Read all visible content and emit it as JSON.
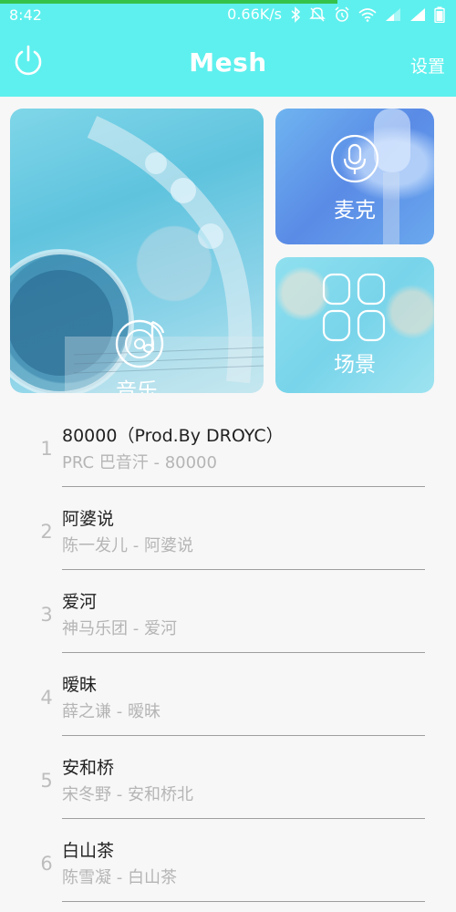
{
  "status_bar": {
    "time": "8:42",
    "net_speed": "0.66K/s",
    "icons": [
      "bluetooth-icon",
      "alarm-off-icon",
      "alarm-icon",
      "wifi-icon",
      "signal-icon",
      "signal-icon",
      "battery-icon"
    ]
  },
  "load_progress": 0.74,
  "app_bar": {
    "title": "Mesh",
    "settings_label": "设置",
    "power_icon": "power-icon"
  },
  "colors": {
    "accent": "#5ef0ee",
    "progress": "#35c24a",
    "text_primary": "#222222",
    "text_secondary": "#b5b5b5"
  },
  "tiles": {
    "music": {
      "label": "音乐",
      "icon": "music-disc-icon"
    },
    "mic": {
      "label": "麦克",
      "icon": "microphone-icon"
    },
    "scene": {
      "label": "场景",
      "icon": "scene-grid-icon"
    }
  },
  "songs": [
    {
      "index": "1",
      "title": "80000（Prod.By DROYC）",
      "subtitle": "PRC 巴音汗 - 80000"
    },
    {
      "index": "2",
      "title": "阿婆说",
      "subtitle": "陈一发儿 - 阿婆说"
    },
    {
      "index": "3",
      "title": "爱河",
      "subtitle": "神马乐团 - 爱河"
    },
    {
      "index": "4",
      "title": "暧昧",
      "subtitle": "薛之谦 - 暧昧"
    },
    {
      "index": "5",
      "title": "安和桥",
      "subtitle": "宋冬野 - 安和桥北"
    },
    {
      "index": "6",
      "title": "白山茶",
      "subtitle": "陈雪凝 - 白山茶"
    }
  ]
}
